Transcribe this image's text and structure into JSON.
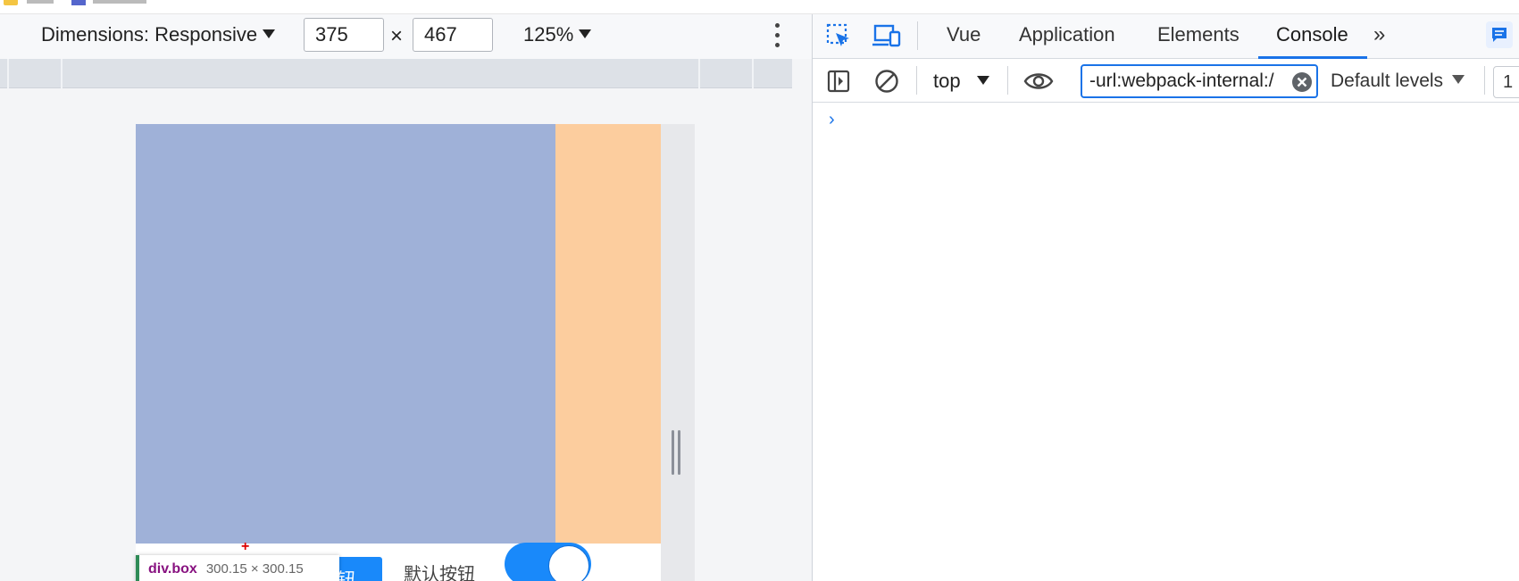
{
  "device_toolbar": {
    "dimensions_label": "Dimensions: Responsive",
    "width_value": "375",
    "times_sign": "×",
    "height_value": "467",
    "zoom_label": "125%"
  },
  "page_preview": {
    "primary_button_label": "按钮",
    "default_button_label": "默认按钮",
    "switch_on": true
  },
  "inspect_tooltip": {
    "element_name": "div.box",
    "element_size": "300.15 × 300.15"
  },
  "devtools": {
    "tabs": [
      {
        "label": "Vue"
      },
      {
        "label": "Application"
      },
      {
        "label": "Elements"
      },
      {
        "label": "Console"
      }
    ],
    "active_tab": "Console",
    "more_tabs_glyph": "»"
  },
  "console": {
    "context": "top",
    "filter_value": "-url:webpack-internal:/",
    "levels_label": "Default levels",
    "issue_count": "1",
    "prompt_glyph": "›"
  },
  "colors": {
    "accent": "#1a73e8",
    "box_blue": "#9fb1d8",
    "box_peach": "#fccd9e",
    "button_blue": "#1989fa"
  },
  "icons": [
    "inspect-element-icon",
    "device-toggle-icon",
    "more-vertical-icon",
    "sidebar-toggle-icon",
    "clear-console-icon",
    "eye-icon",
    "clear-filter-icon",
    "issues-icon"
  ]
}
